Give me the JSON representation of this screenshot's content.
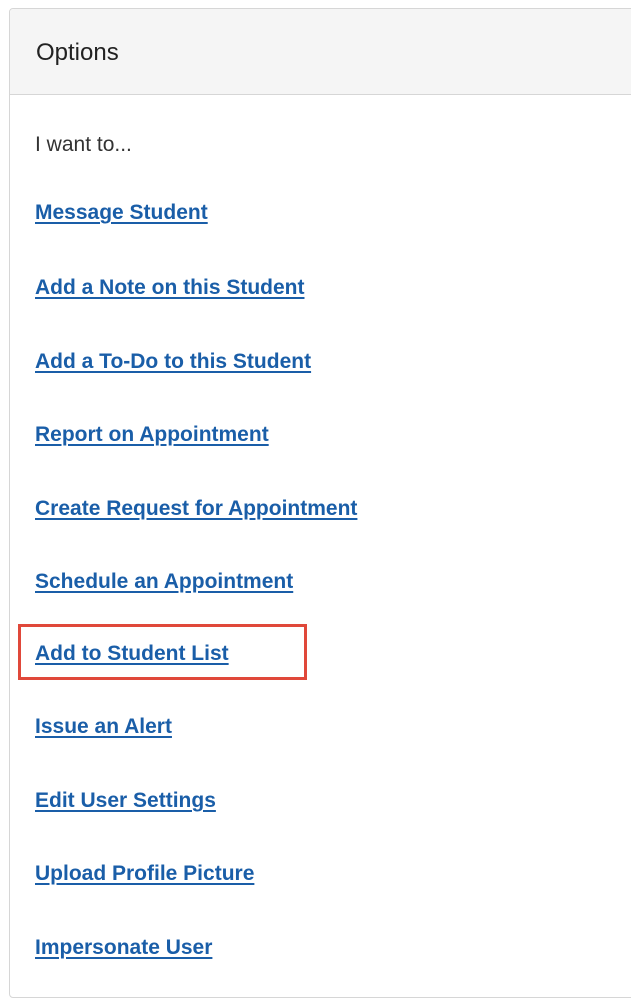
{
  "panel": {
    "title": "Options",
    "intro": "I want to..."
  },
  "options": [
    {
      "label": "Message Student"
    },
    {
      "label": "Add a Note on this Student"
    },
    {
      "label": "Add a To-Do to this Student"
    },
    {
      "label": "Report on Appointment"
    },
    {
      "label": "Create Request for Appointment"
    },
    {
      "label": "Schedule an Appointment"
    },
    {
      "label": "Add to Student List"
    },
    {
      "label": "Issue an Alert"
    },
    {
      "label": "Edit User Settings"
    },
    {
      "label": "Upload Profile Picture"
    },
    {
      "label": "Impersonate User"
    }
  ],
  "colors": {
    "link": "#1a5ea8",
    "highlight": "#e0483a",
    "header_bg": "#f5f5f5"
  }
}
